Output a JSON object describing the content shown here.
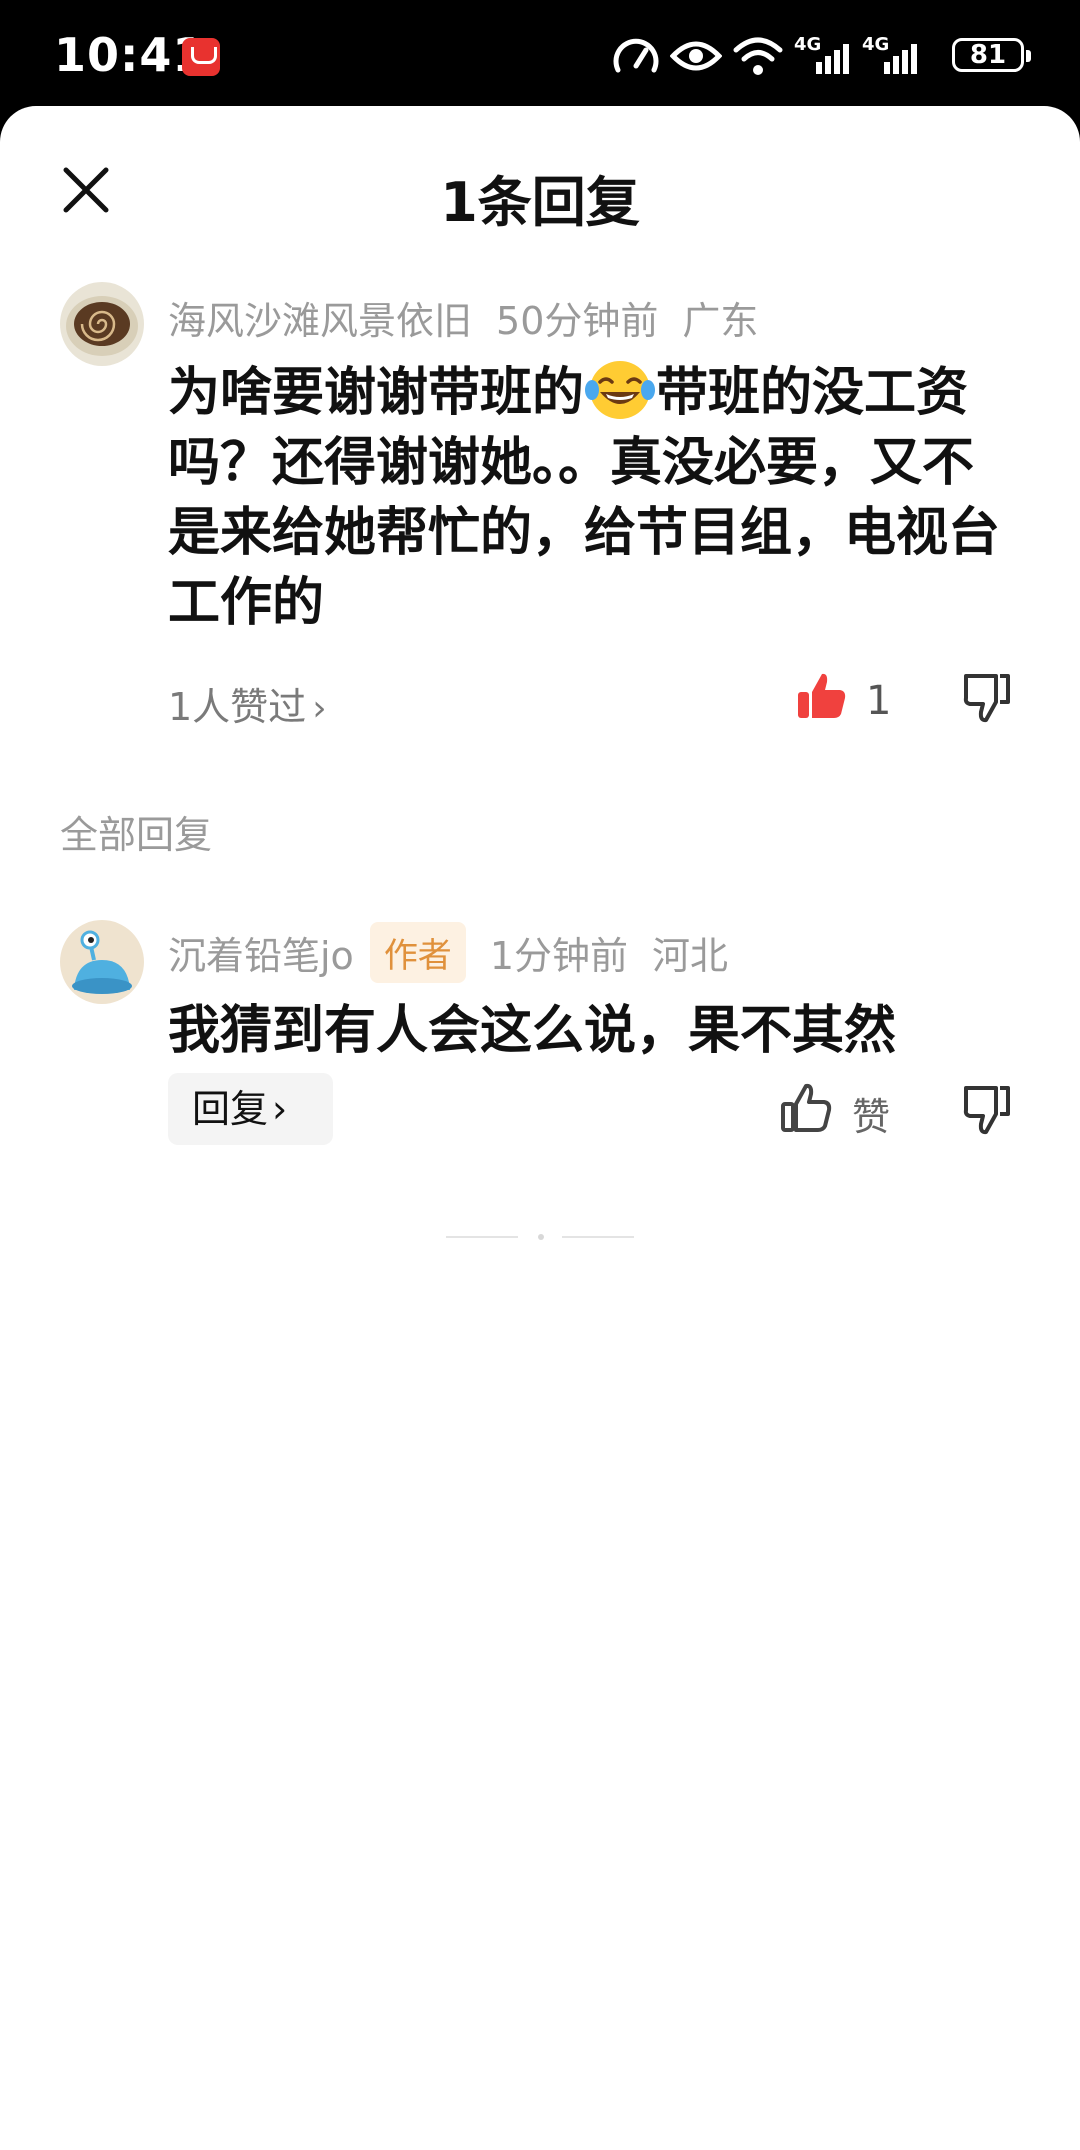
{
  "status_bar": {
    "time": "10:41",
    "app_badge_icon": "huawei-appgallery-icon",
    "icons": [
      "speed-icon",
      "eye-icon",
      "wifi-icon",
      "4g-signal-icon",
      "4g-signal-icon"
    ],
    "signal_label_1": "4G",
    "signal_label_2": "4G",
    "battery": "81"
  },
  "header": {
    "title": "1条回复",
    "close_icon": "close-icon"
  },
  "main_comment": {
    "username": "海风沙滩风景依旧",
    "time": "50分钟前",
    "location": "广东",
    "text_part1": "为啥要谢谢带班的",
    "emoji": "face-with-tears-of-joy",
    "text_part2": "带班的没工资吗？还得谢谢她。。真没必要，又不是来给她帮忙的，给节目组，电视台工作的",
    "likes_link": "1人赞过",
    "like_count": "1",
    "liked": true,
    "like_color": "#f0413e"
  },
  "replies_section": {
    "title": "全部回复"
  },
  "reply": {
    "username": "沉着铅笔jo",
    "author_tag": "作者",
    "time": "1分钟前",
    "location": "河北",
    "text": "我猜到有人会这么说，果不其然",
    "reply_button": "回复",
    "like_label": "赞"
  }
}
